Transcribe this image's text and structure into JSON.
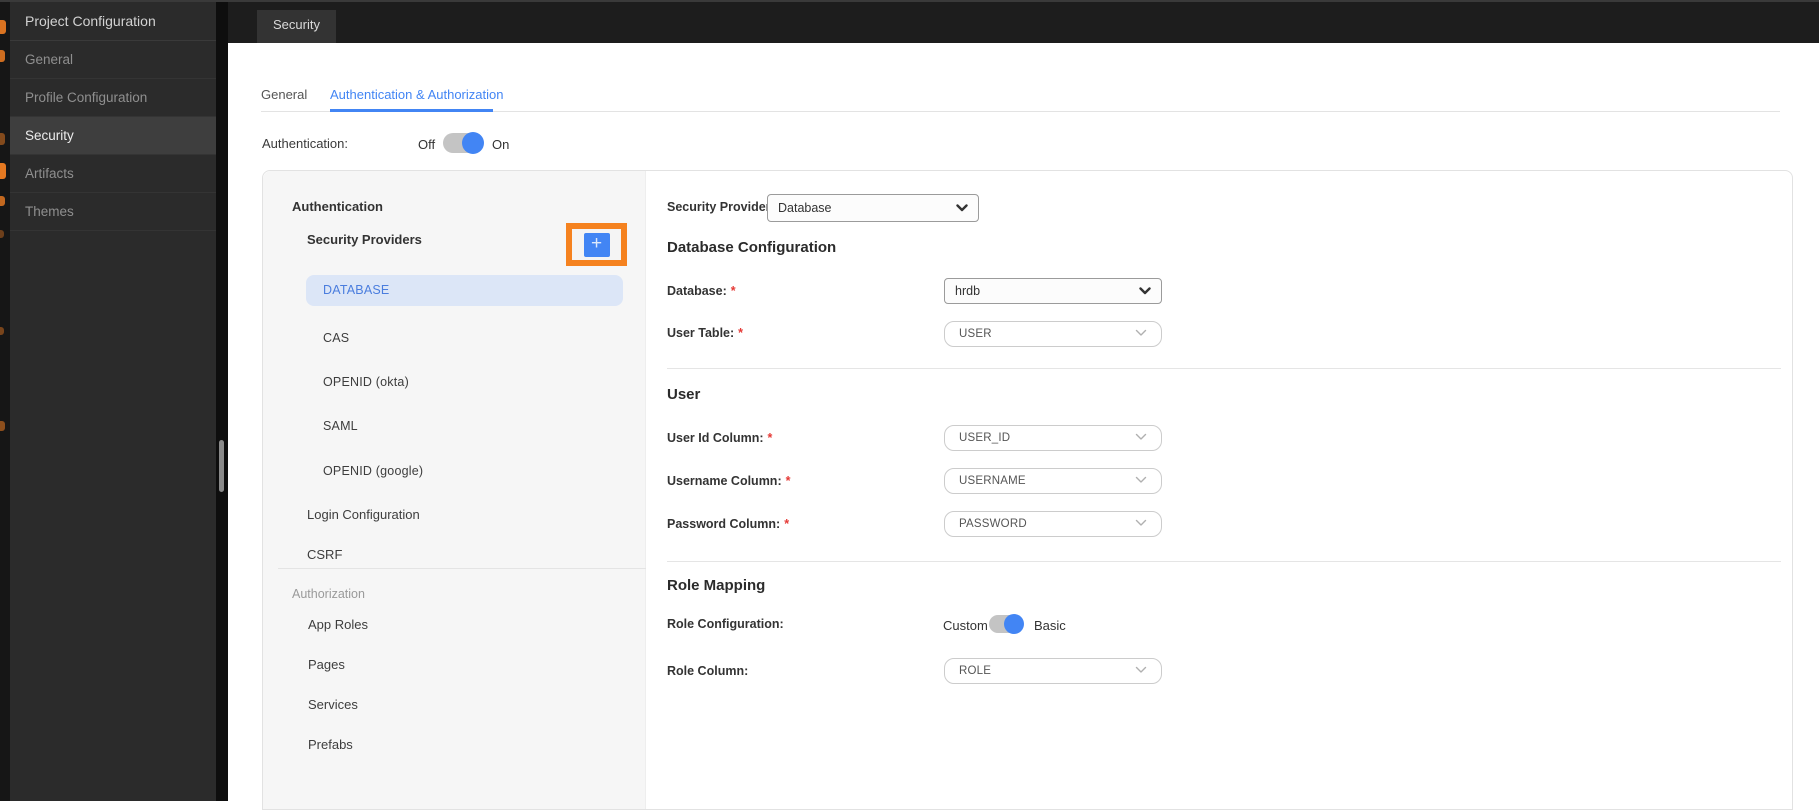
{
  "colors": {
    "accent": "#4285f4",
    "highlight_orange": "#f5821f",
    "selected_item_bg": "#dce6f7"
  },
  "sidebar": {
    "title": "Project Configuration",
    "items": [
      {
        "label": "General",
        "active": false
      },
      {
        "label": "Profile Configuration",
        "active": false
      },
      {
        "label": "Security",
        "active": true
      },
      {
        "label": "Artifacts",
        "active": false
      },
      {
        "label": "Themes",
        "active": false
      }
    ]
  },
  "topbar": {
    "active_tab": "Security"
  },
  "page_tabs": {
    "general": "General",
    "auth": "Authentication & Authorization"
  },
  "auth_row": {
    "label": "Authentication:",
    "off": "Off",
    "on": "On",
    "state": "on"
  },
  "nav": {
    "section_authentication": "Authentication",
    "security_providers_label": "Security Providers",
    "add_icon": "+",
    "providers": [
      {
        "label": "DATABASE",
        "selected": true
      },
      {
        "label": "CAS",
        "selected": false
      },
      {
        "label": "OPENID (okta)",
        "selected": false
      },
      {
        "label": "SAML",
        "selected": false
      },
      {
        "label": "OPENID (google)",
        "selected": false
      }
    ],
    "login_configuration": "Login Configuration",
    "csrf": "CSRF",
    "section_authorization": "Authorization",
    "authorization_items": [
      {
        "label": "App Roles"
      },
      {
        "label": "Pages"
      },
      {
        "label": "Services"
      },
      {
        "label": "Prefabs"
      }
    ]
  },
  "form": {
    "required_marker": "*",
    "security_provider": {
      "label": "Security Provider",
      "value": "Database"
    },
    "database_section": {
      "heading": "Database Configuration",
      "database": {
        "label": "Database:",
        "value": "hrdb",
        "required": true
      },
      "user_table": {
        "label": "User Table:",
        "value": "USER",
        "required": true
      }
    },
    "user_section": {
      "heading": "User",
      "user_id": {
        "label": "User Id Column:",
        "value": "USER_ID",
        "required": true
      },
      "username": {
        "label": "Username Column:",
        "value": "USERNAME",
        "required": true
      },
      "password": {
        "label": "Password Column:",
        "value": "PASSWORD",
        "required": true
      }
    },
    "role_section": {
      "heading": "Role Mapping",
      "role_configuration": {
        "label": "Role Configuration:",
        "left": "Custom",
        "right": "Basic",
        "state": "right"
      },
      "role_column": {
        "label": "Role Column:",
        "value": "ROLE"
      }
    }
  }
}
